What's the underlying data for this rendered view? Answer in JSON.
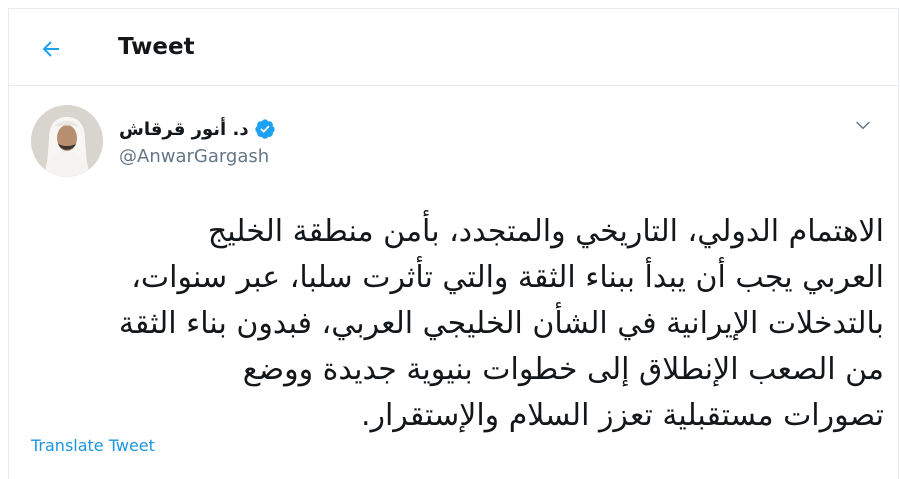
{
  "header": {
    "title": "Tweet",
    "back_icon": "arrow-left-icon"
  },
  "colors": {
    "accent": "#1da1f2",
    "link": "#1b95e0",
    "text": "#14171a",
    "secondary_text": "#657786",
    "divider": "#e6ecf0"
  },
  "tweet": {
    "author_name": "د. أنور قرقاش",
    "verified_icon": "verified-badge-icon",
    "handle": "@AnwarGargash",
    "menu_icon": "chevron-down-icon",
    "lines": [
      "الاهتمام الدولي، التاريخي والمتجدد، بأمن منطقة الخليج",
      "العربي يجب أن يبدأ ببناء الثقة والتي تأثرت سلبا، عبر سنوات،",
      "بالتدخلات الإيرانية في الشأن الخليجي العربي، فبدون بناء الثقة",
      "من الصعب الإنطلاق إلى خطوات بنيوية جديدة ووضع",
      "تصورات مستقبلية تعزز السلام والإستقرار."
    ],
    "translate_label": "Translate Tweet"
  }
}
